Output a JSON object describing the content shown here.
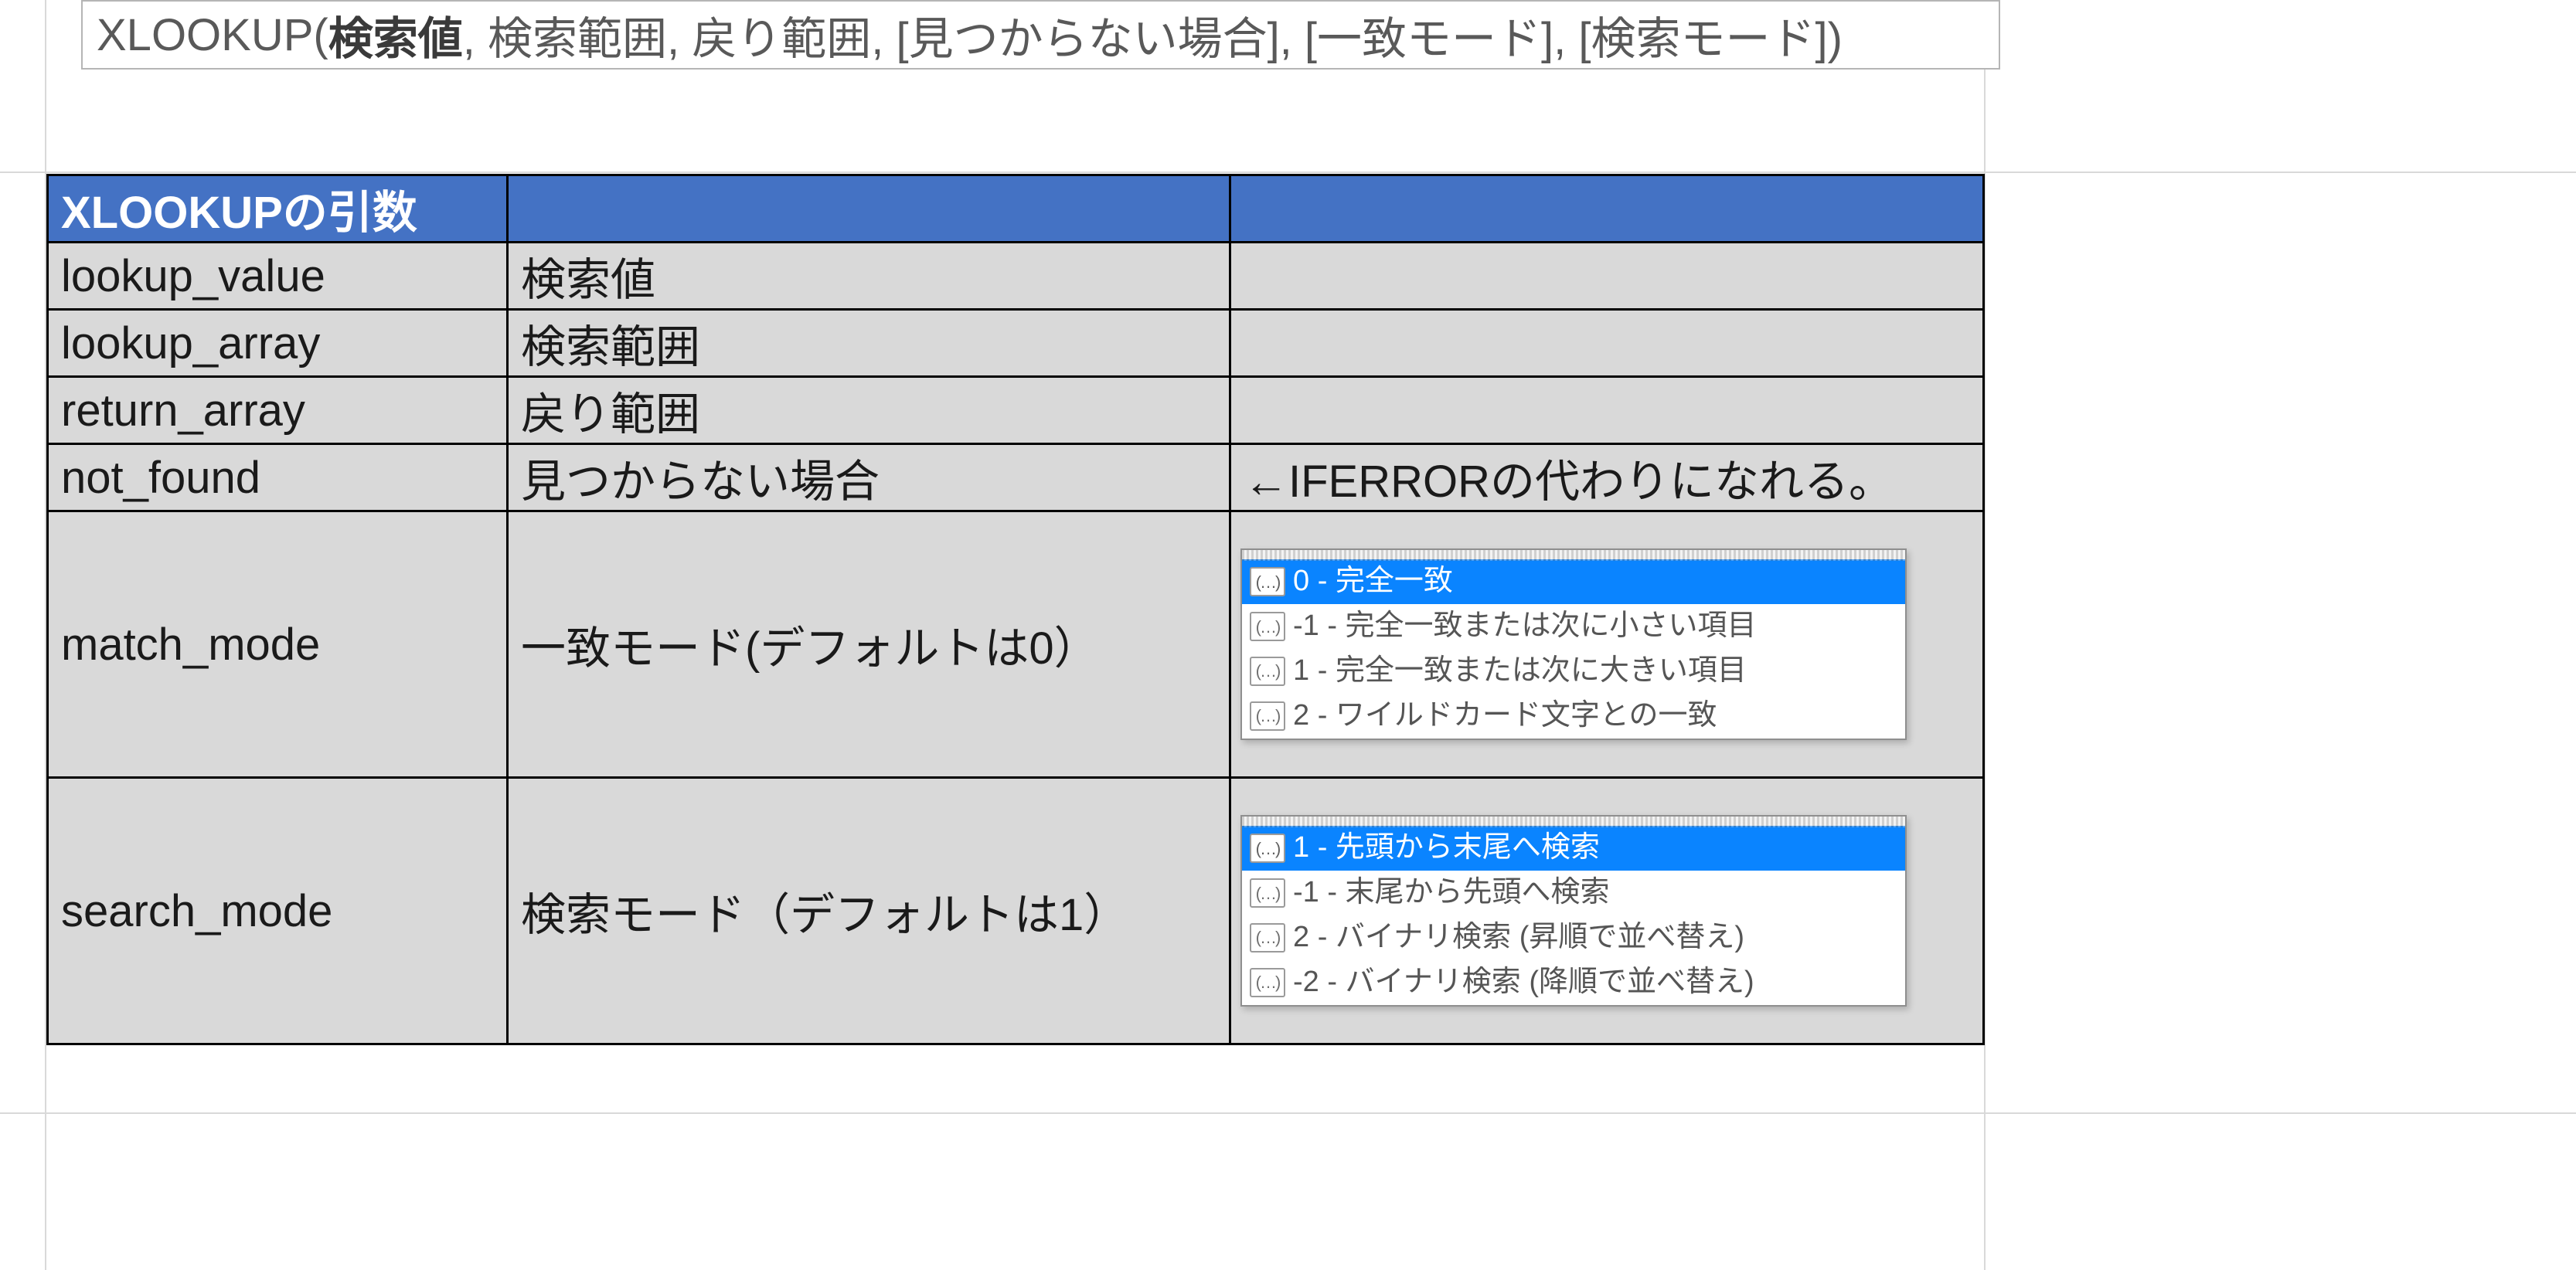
{
  "syntax": {
    "func": "XLOOKUP(",
    "arg_bold": "検索値",
    "rest": ", 検索範囲, 戻り範囲, [見つからない場合], [一致モード], [検索モード])"
  },
  "table": {
    "header": {
      "c1": "XLOOKUPの引数",
      "c2": "",
      "c3": ""
    },
    "rows": [
      {
        "c1": "lookup_value",
        "c2": "検索値",
        "c3": ""
      },
      {
        "c1": "lookup_array",
        "c2": "検索範囲",
        "c3": ""
      },
      {
        "c1": "return_array",
        "c2": "戻り範囲",
        "c3": ""
      },
      {
        "c1": "not_found",
        "c2": "見つからない場合",
        "c3": "←IFERRORの代わりになれる。"
      },
      {
        "c1": "match_mode",
        "c2": "一致モード(デフォルトは0）",
        "c3_type": "dropdown",
        "c3_ref": "match_mode"
      },
      {
        "c1": "search_mode",
        "c2": "検索モード（デフォルトは1）",
        "c3_type": "dropdown",
        "c3_ref": "search_mode"
      }
    ]
  },
  "dropdowns": {
    "icon_glyph": "(…)",
    "match_mode": {
      "selected_index": 0,
      "options": [
        {
          "text": "0 - 完全一致"
        },
        {
          "text": "-1 - 完全一致または次に小さい項目"
        },
        {
          "text": "1 - 完全一致または次に大きい項目"
        },
        {
          "text": "2 - ワイルドカード文字との一致"
        }
      ]
    },
    "search_mode": {
      "selected_index": 0,
      "options": [
        {
          "text": "1 - 先頭から末尾へ検索"
        },
        {
          "text": "-1 - 末尾から先頭へ検索"
        },
        {
          "text": "2 - バイナリ検索 (昇順で並べ替え)"
        },
        {
          "text": "-2 - バイナリ検索 (降順で並べ替え)"
        }
      ]
    }
  }
}
